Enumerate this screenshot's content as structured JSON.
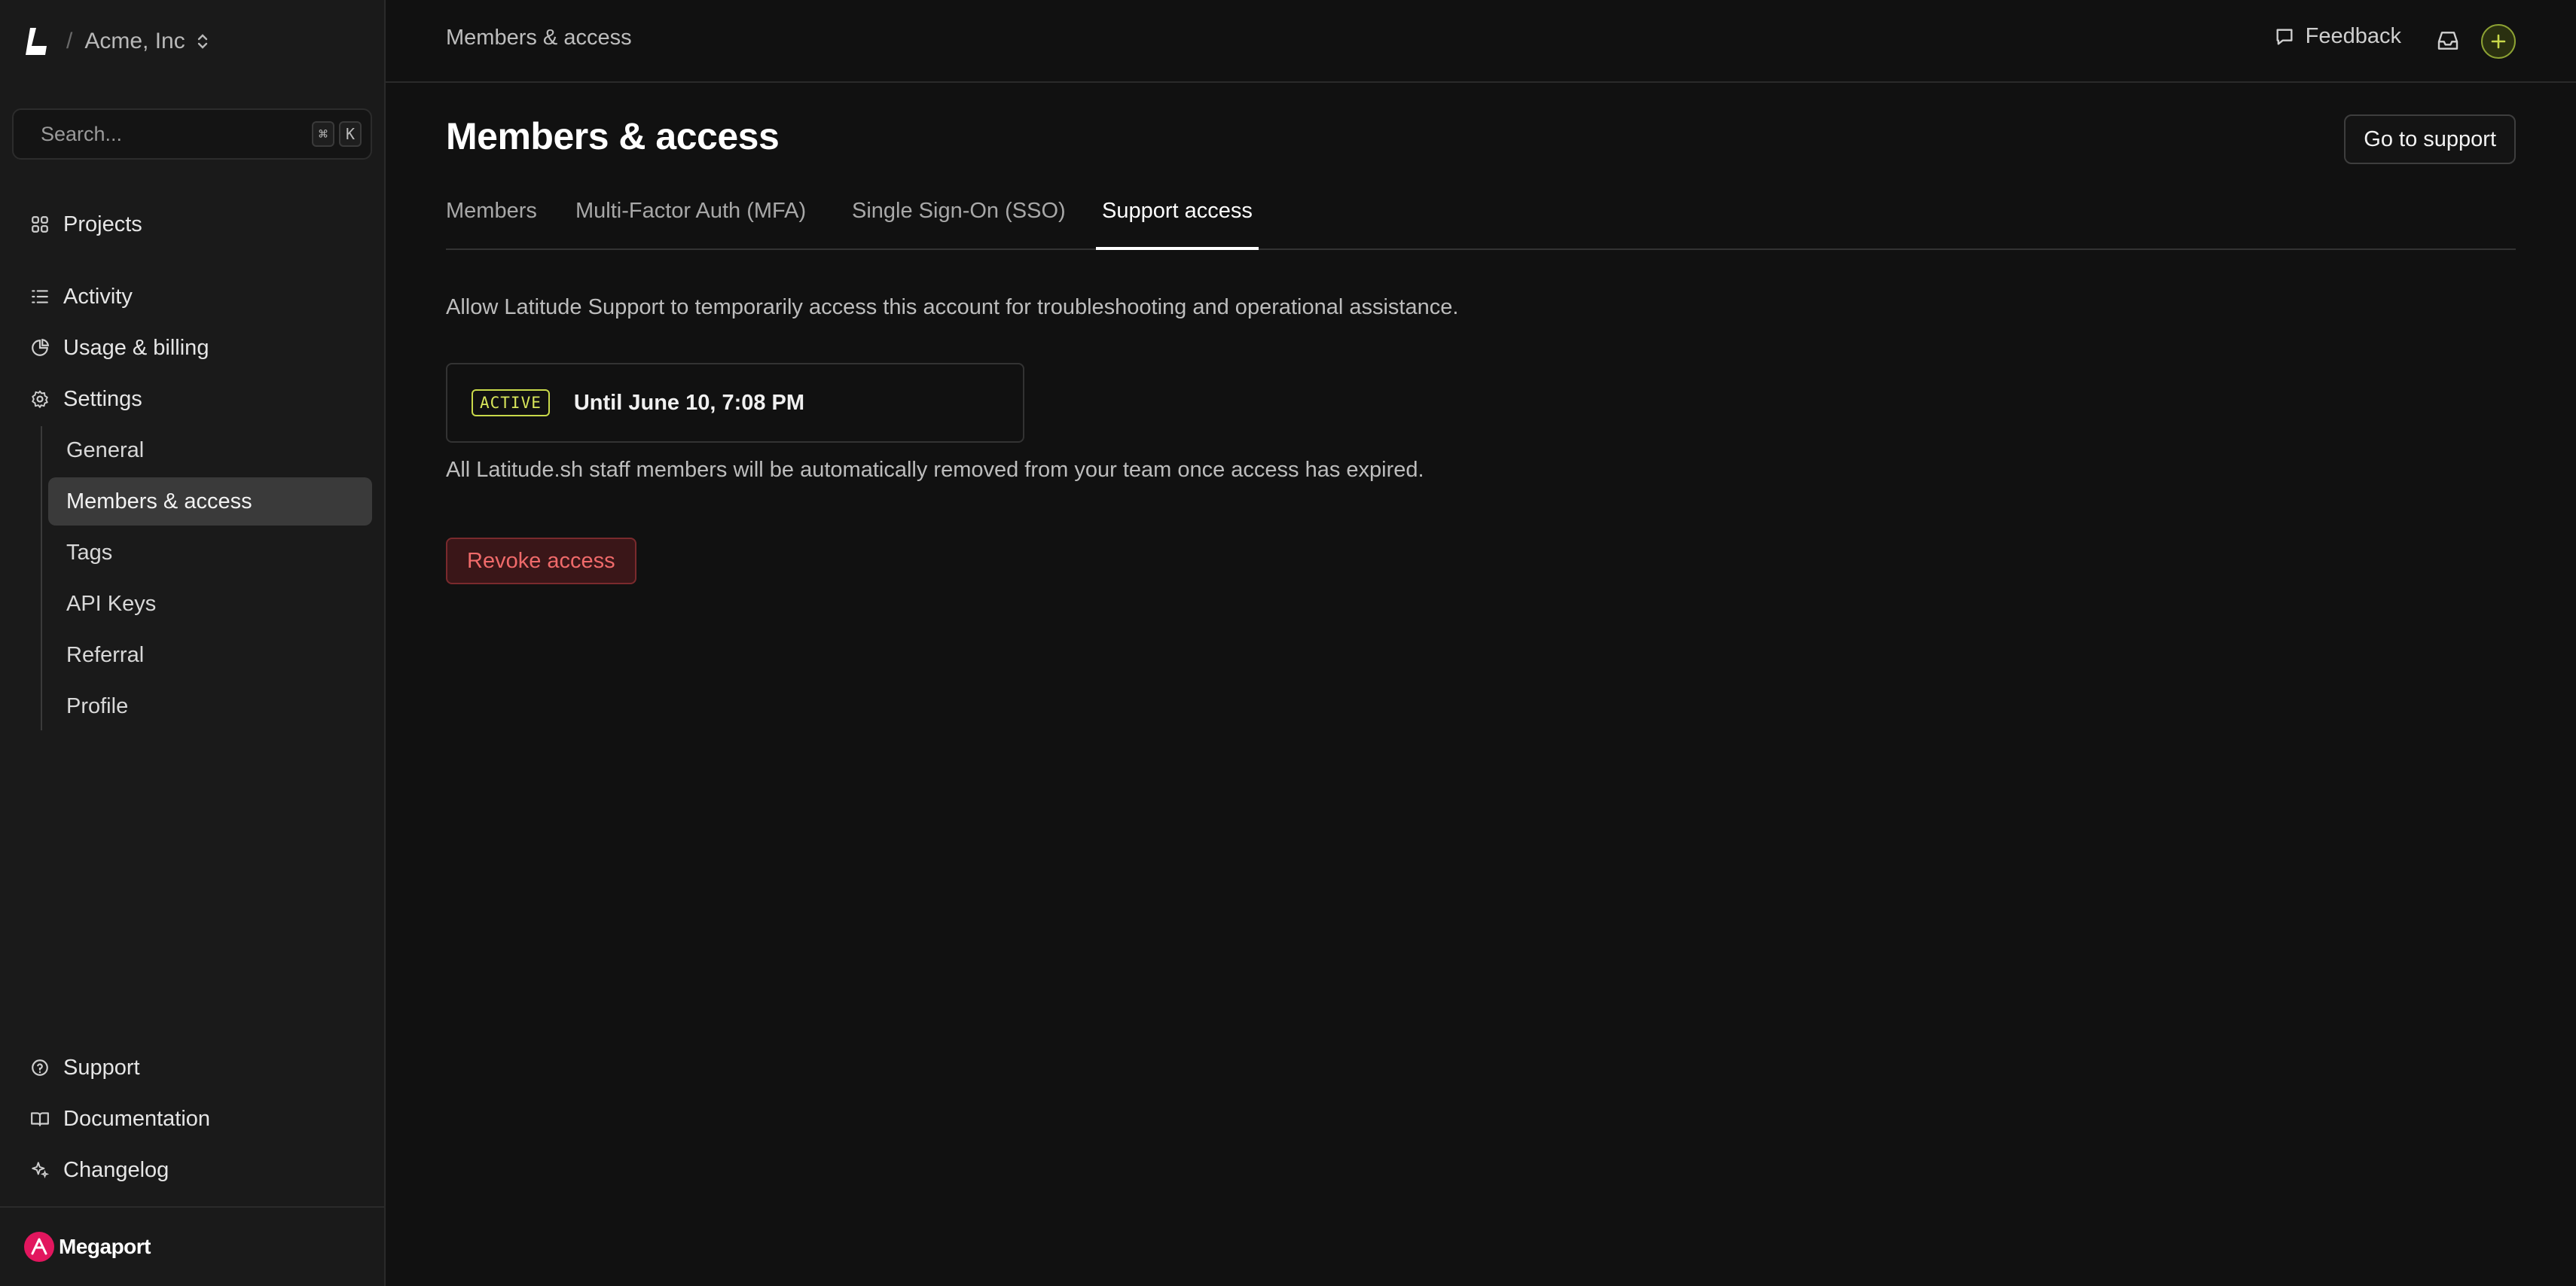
{
  "brand": {
    "separator": "/",
    "org_name": "Acme, Inc"
  },
  "search": {
    "placeholder": "Search...",
    "shortcut_mod": "⌘",
    "shortcut_key": "K"
  },
  "sidebar": {
    "items": [
      {
        "label": "Projects",
        "icon": "grid-icon"
      },
      {
        "label": "Activity",
        "icon": "list-icon"
      },
      {
        "label": "Usage & billing",
        "icon": "pie-chart-icon"
      },
      {
        "label": "Settings",
        "icon": "gear-icon"
      }
    ],
    "settings_children": [
      {
        "label": "General"
      },
      {
        "label": "Members & access",
        "active": true
      },
      {
        "label": "Tags"
      },
      {
        "label": "API Keys"
      },
      {
        "label": "Referral"
      },
      {
        "label": "Profile"
      }
    ],
    "bottom_items": [
      {
        "label": "Support",
        "icon": "help-circle-icon"
      },
      {
        "label": "Documentation",
        "icon": "book-icon"
      },
      {
        "label": "Changelog",
        "icon": "sparkle-icon"
      }
    ],
    "partner": "Megaport"
  },
  "topbar": {
    "breadcrumb": "Members & access",
    "feedback_label": "Feedback"
  },
  "main": {
    "title": "Members & access",
    "support_button": "Go to support",
    "tabs": [
      {
        "label": "Members"
      },
      {
        "label": "Multi-Factor Auth (MFA)"
      },
      {
        "label": "Single Sign-On (SSO)"
      },
      {
        "label": "Support access",
        "active": true
      }
    ],
    "description": "Allow Latitude Support to temporarily access this account for troubleshooting and operational assistance.",
    "status_badge": "ACTIVE",
    "status_until": "Until June 10, 7:08 PM",
    "note": "All Latitude.sh staff members will be automatically removed from your team once access has expired.",
    "revoke_button": "Revoke access"
  },
  "colors": {
    "background": "#111111",
    "sidebar": "#1a1a1a",
    "accent_active": "#d8e65a",
    "danger": "#ef6a6a",
    "brand_partner": "#e2165e"
  }
}
